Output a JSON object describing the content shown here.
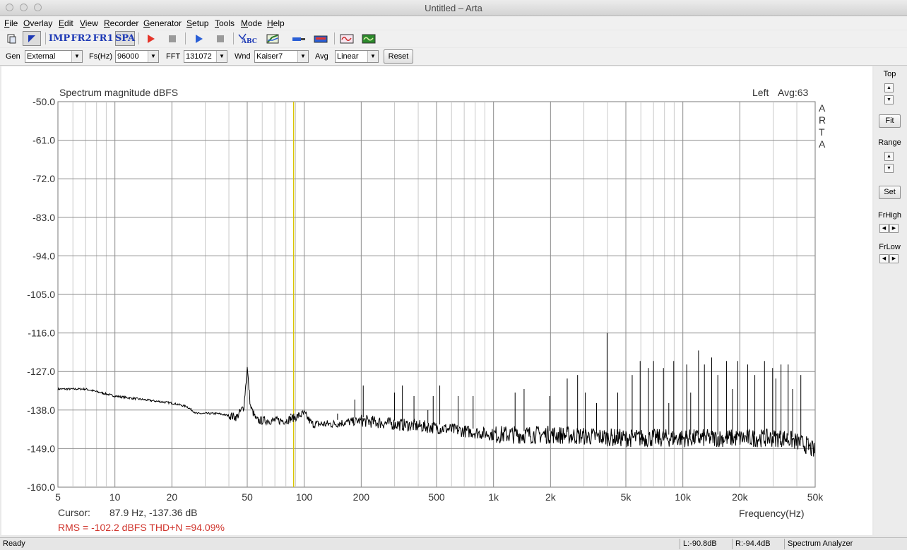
{
  "window": {
    "title": "Untitled – Arta"
  },
  "menu": [
    "File",
    "Overlay",
    "Edit",
    "View",
    "Recorder",
    "Generator",
    "Setup",
    "Tools",
    "Mode",
    "Help"
  ],
  "toolbar": {
    "imp": "IMP",
    "fr2": "FR2",
    "fr1": "FR1",
    "spa": "SPA",
    "abc": "ABC"
  },
  "controls": {
    "gen_label": "Gen",
    "gen_value": "External",
    "fs_label": "Fs(Hz)",
    "fs_value": "96000",
    "fft_label": "FFT",
    "fft_value": "131072",
    "wnd_label": "Wnd",
    "wnd_value": "Kaiser7",
    "avg_label": "Avg",
    "avg_value": "Linear",
    "reset_label": "Reset"
  },
  "sidebar": {
    "top_label": "Top",
    "fit_label": "Fit",
    "range_label": "Range",
    "set_label": "Set",
    "frhigh_label": "FrHigh",
    "frlow_label": "FrLow"
  },
  "plot": {
    "title": "Spectrum magnitude dBFS",
    "channel": "Left",
    "avg": "Avg:63",
    "brand_letters": [
      "A",
      "R",
      "T",
      "A"
    ],
    "cursor_label": "Cursor:",
    "cursor_value": "87.9 Hz, -137.36 dB",
    "rms_text": "RMS = -102.2 dBFS   THD+N =94.09%"
  },
  "status": {
    "ready": "Ready",
    "left_level": "L:-90.8dB",
    "right_level": "R:-94.4dB",
    "mode": "Spectrum Analyzer"
  },
  "chart_data": {
    "type": "line",
    "xlabel": "Frequency(Hz)",
    "ylabel": "",
    "xscale": "log",
    "xlim": [
      5,
      50000
    ],
    "ylim": [
      -160,
      -50
    ],
    "y_ticks": [
      "-50.0",
      "-61.0",
      "-72.0",
      "-83.0",
      "-94.0",
      "-105.0",
      "-116.0",
      "-127.0",
      "-138.0",
      "-149.0",
      "-160.0"
    ],
    "x_ticks": [
      {
        "v": 5,
        "label": "5"
      },
      {
        "v": 10,
        "label": "10"
      },
      {
        "v": 20,
        "label": "20"
      },
      {
        "v": 50,
        "label": "50"
      },
      {
        "v": 100,
        "label": "100"
      },
      {
        "v": 200,
        "label": "200"
      },
      {
        "v": 500,
        "label": "500"
      },
      {
        "v": 1000,
        "label": "1k"
      },
      {
        "v": 2000,
        "label": "2k"
      },
      {
        "v": 5000,
        "label": "5k"
      },
      {
        "v": 10000,
        "label": "10k"
      },
      {
        "v": 20000,
        "label": "20k"
      },
      {
        "v": 50000,
        "label": "50k"
      }
    ],
    "grid": true,
    "cursor_hz": 87.9,
    "series": [
      {
        "values": [
          [
            5,
            -132
          ],
          [
            7,
            -132
          ],
          [
            10,
            -134
          ],
          [
            14,
            -135
          ],
          [
            20,
            -136
          ],
          [
            24,
            -137
          ],
          [
            27,
            -139
          ],
          [
            35,
            -139
          ],
          [
            44,
            -140
          ],
          [
            48,
            -137
          ],
          [
            50,
            -126
          ],
          [
            52,
            -137
          ],
          [
            56,
            -141
          ],
          [
            70,
            -141
          ],
          [
            80,
            -141
          ],
          [
            90,
            -140
          ],
          [
            100,
            -139
          ],
          [
            110,
            -142
          ],
          [
            140,
            -142
          ],
          [
            200,
            -141
          ],
          [
            300,
            -142
          ],
          [
            500,
            -143
          ],
          [
            700,
            -144
          ],
          [
            1000,
            -145
          ],
          [
            2000,
            -145
          ],
          [
            5000,
            -146
          ],
          [
            10000,
            -146
          ],
          [
            20000,
            -146
          ],
          [
            35000,
            -146
          ],
          [
            45000,
            -148
          ],
          [
            50000,
            -150
          ]
        ]
      }
    ],
    "peaks": [
      [
        85,
        -139
      ],
      [
        98,
        -138
      ],
      [
        150,
        -139
      ],
      [
        185,
        -135
      ],
      [
        205,
        -131
      ],
      [
        300,
        -133
      ],
      [
        330,
        -131
      ],
      [
        380,
        -134
      ],
      [
        450,
        -138
      ],
      [
        480,
        -134
      ],
      [
        520,
        -131
      ],
      [
        650,
        -134
      ],
      [
        780,
        -134
      ],
      [
        1300,
        -133
      ],
      [
        1450,
        -132
      ],
      [
        1980,
        -134
      ],
      [
        2450,
        -129
      ],
      [
        2780,
        -128
      ],
      [
        3050,
        -133
      ],
      [
        3500,
        -136
      ],
      [
        3980,
        -116
      ],
      [
        4530,
        -133
      ],
      [
        5400,
        -128
      ],
      [
        5950,
        -124
      ],
      [
        6580,
        -126
      ],
      [
        7000,
        -124
      ],
      [
        7900,
        -126
      ],
      [
        8430,
        -136
      ],
      [
        8950,
        -124
      ],
      [
        10480,
        -125
      ],
      [
        11000,
        -133
      ],
      [
        12100,
        -121
      ],
      [
        13000,
        -125
      ],
      [
        14200,
        -123
      ],
      [
        15300,
        -128
      ],
      [
        17000,
        -124
      ],
      [
        18300,
        -132
      ],
      [
        19500,
        -124
      ],
      [
        22000,
        -125
      ],
      [
        24000,
        -128
      ],
      [
        27000,
        -124
      ],
      [
        29800,
        -126
      ],
      [
        31000,
        -129
      ],
      [
        33000,
        -125
      ],
      [
        36000,
        -125
      ],
      [
        38000,
        -132
      ],
      [
        42000,
        -128
      ]
    ]
  }
}
